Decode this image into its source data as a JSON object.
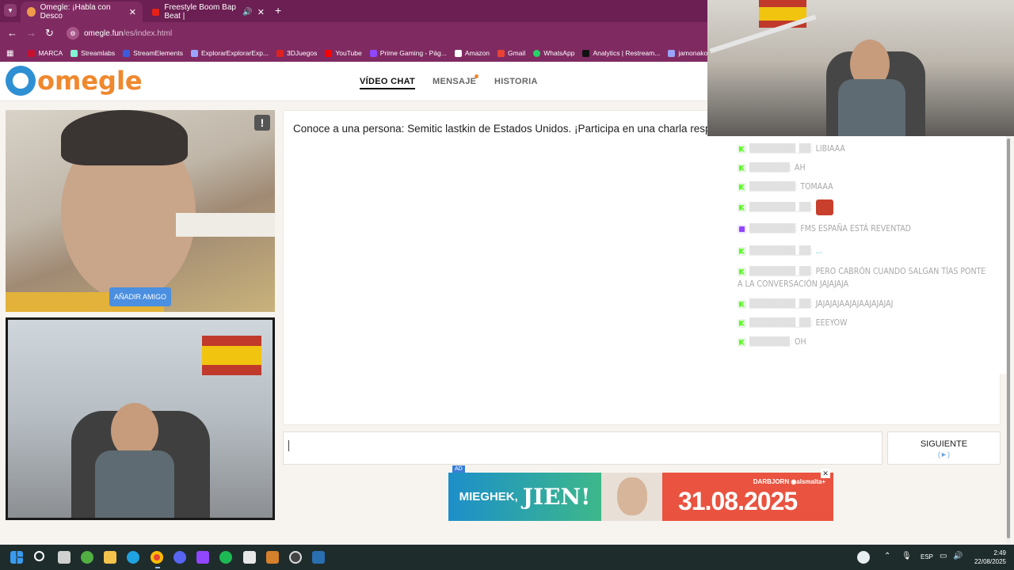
{
  "browser": {
    "tabs": [
      {
        "title": "Omegle: ¡Habla con Desco",
        "active": true
      },
      {
        "title": "Freestyle Boom Bap Beat |",
        "active": false
      }
    ],
    "url": {
      "host": "omegle.fun",
      "path": "/es/index.html"
    },
    "bookmarks": [
      "MARCA",
      "Streamlabs",
      "StreamElements",
      "ExplorarExplorarExp...",
      "3DJuegos",
      "YouTube",
      "Prime Gaming - Pág...",
      "Amazon",
      "Gmail",
      "WhatsApp",
      "Analytics | Restream...",
      "jamonakotv - T"
    ]
  },
  "omegle": {
    "logo": "omegle",
    "nav": {
      "video_chat": "VÍDEO CHAT",
      "message": "MENSAJE",
      "history": "HISTORIA"
    },
    "add_friend": "AÑADIR AMIGO",
    "report": "!",
    "chat_intro": "Conoce a una persona: Semitic lastkin de Estados Unidos. ¡Participa en una charla resp",
    "next_button": "SIGUIENTE",
    "next_sub": "(►)"
  },
  "ad": {
    "badge": "AD",
    "left_text_a": "MIEGHEK,",
    "left_text_b": "JIEN!",
    "brand": "DARBJORN  ◉alsmalta+",
    "date": "31.08.2025",
    "close": "✕"
  },
  "overlay_chat": [
    {
      "platform": "kick",
      "user": "████████_██:",
      "text": "LIBIAAA"
    },
    {
      "platform": "kick",
      "user": "███████:",
      "text": "AH"
    },
    {
      "platform": "kick",
      "user": "████████:",
      "text": "TOMAAA"
    },
    {
      "platform": "kick",
      "user": "████████_██:",
      "text": "",
      "emote": true
    },
    {
      "platform": "twitch",
      "user": "████████:",
      "text": "FMS ESPAÑA ESTÁ REVENTAD"
    },
    {
      "platform": "kick",
      "user": "████████_██:",
      "text": "..."
    },
    {
      "platform": "kick",
      "user": "████████_██:",
      "text": "PERO CABRÓN CUANDO SALGAN TÍAS PONTE A LA CONVERSACIÓN JAJAJAJA"
    },
    {
      "platform": "kick",
      "user": "████████_██:",
      "text": "JAJAJAJAAJAJAAJAJAJAJ"
    },
    {
      "platform": "kick",
      "user": "████████_██:",
      "text": "EEEYOW"
    },
    {
      "platform": "kick",
      "user": "███████:",
      "text": "OH"
    }
  ],
  "taskbar": {
    "lang": "ESP",
    "time": "2:49",
    "date": "22/08/2025"
  },
  "colors": {
    "tabbar": "#6b1f52",
    "omegle_orange": "#f0882d",
    "omegle_blue": "#2e8fd3",
    "kick_green": "#53fc18"
  }
}
